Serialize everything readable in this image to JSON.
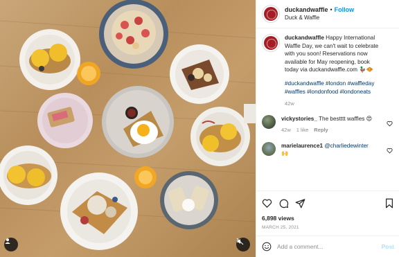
{
  "header": {
    "username": "duckandwaffle",
    "separator": "•",
    "follow_label": "Follow",
    "subtitle": "Duck & Waffle"
  },
  "caption": {
    "username": "duckandwaffle",
    "text_lines": [
      "Happy International",
      "Waffle Day, we can't wait to celebrate",
      "with you soon! Reservations now",
      "available for May reopening, book",
      "today via duckandwaffle.com 🦆🧇"
    ],
    "hashtag_lines": [
      "#duckandwaffle #london #waffleday",
      "#waffles #londonfood #londoneats"
    ],
    "age": "42w"
  },
  "comments": [
    {
      "username": "vickystories_",
      "text": "The bestttt waffles 😍",
      "age": "42w",
      "likes": "1 like",
      "reply": "Reply"
    },
    {
      "username": "marielaurence1",
      "mention": "@charliedewinter",
      "emoji": "🙌"
    }
  ],
  "stats": {
    "views": "6,898 views",
    "date": "MARCH 25, 2021"
  },
  "add_comment": {
    "placeholder": "Add a comment...",
    "post_label": "Post"
  },
  "icons": {
    "tag": "user-tag-icon",
    "mute": "mute-icon",
    "like": "heart-icon",
    "comment": "comment-icon",
    "share": "share-icon",
    "save": "bookmark-icon",
    "emoji": "emoji-icon"
  },
  "colors": {
    "follow": "#0095f6",
    "brand_avatar": "#a51d24",
    "secondary_text": "#8e8e8e",
    "hashtag": "#00376b",
    "post_disabled": "#b2dffc"
  }
}
